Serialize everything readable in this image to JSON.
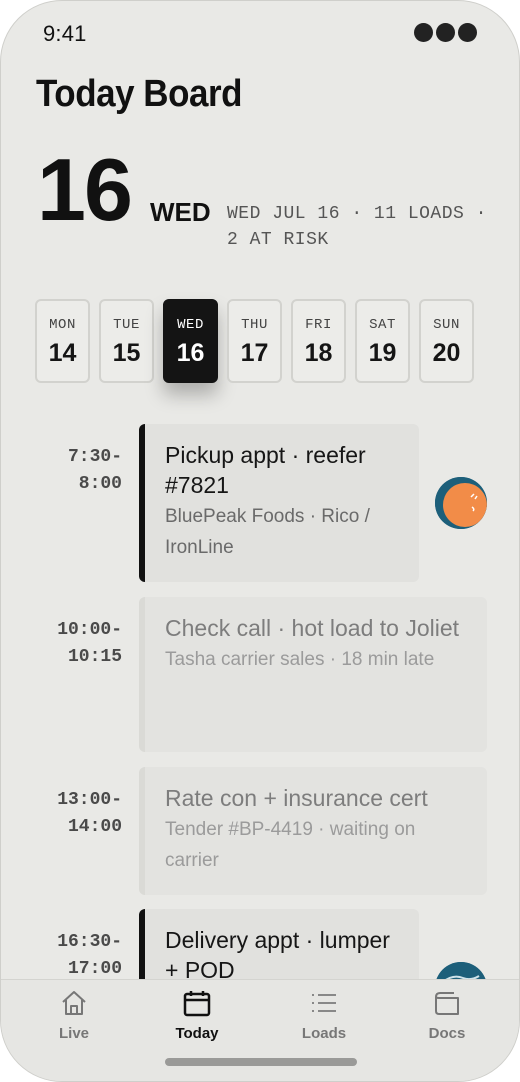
{
  "status_bar": {
    "time": "9:41"
  },
  "page_title": "Today Board",
  "date_header": {
    "day_number": "16",
    "day_of_week": "WED",
    "meta": "WED JUL 16 · 11 LOADS · 2 AT RISK"
  },
  "week": [
    {
      "name": "MON",
      "num": "14",
      "active": false
    },
    {
      "name": "TUE",
      "num": "15",
      "active": false
    },
    {
      "name": "WED",
      "num": "16",
      "active": true
    },
    {
      "name": "THU",
      "num": "17",
      "active": false
    },
    {
      "name": "FRI",
      "num": "18",
      "active": false
    },
    {
      "name": "SAT",
      "num": "19",
      "active": false
    },
    {
      "name": "SUN",
      "num": "20",
      "active": false
    }
  ],
  "agenda": [
    {
      "time_start": "7:30-",
      "time_end": "8:00",
      "title": "Pickup appt · reefer #7821",
      "subtitle": "BluePeak Foods · Rico / IronLine",
      "state": "active",
      "has_avatar": true
    },
    {
      "time_start": "10:00-",
      "time_end": "10:15",
      "title": "Check call · hot load to Joliet",
      "subtitle": "Tasha carrier sales · 18 min late",
      "state": "dim",
      "has_avatar": false
    },
    {
      "time_start": "13:00-",
      "time_end": "14:00",
      "title": "Rate con + insurance cert",
      "subtitle": "Tender #BP-4419 · waiting on carrier",
      "state": "dim",
      "has_avatar": false
    },
    {
      "time_start": "16:30-",
      "time_end": "17:00",
      "title": "Delivery appt · lumper + POD",
      "subtitle": "",
      "state": "active",
      "has_avatar": true
    }
  ],
  "tab_bar": {
    "tabs": [
      {
        "label": "Live",
        "icon": "home-icon",
        "active": false
      },
      {
        "label": "Today",
        "icon": "calendar-icon",
        "active": true
      },
      {
        "label": "Loads",
        "icon": "list-icon",
        "active": false
      },
      {
        "label": "Docs",
        "icon": "wallet-icon",
        "active": false
      }
    ]
  },
  "colors": {
    "background": "#e9e9e6",
    "accent": "#111111",
    "avatar_orange": "#f28c48",
    "avatar_blue": "#1d5f7a"
  }
}
